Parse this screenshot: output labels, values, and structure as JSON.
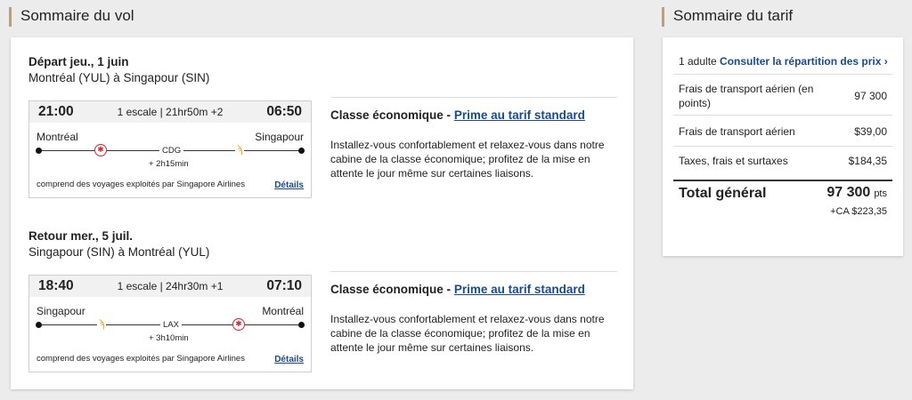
{
  "flight_summary": {
    "title": "Sommaire du vol",
    "legs": [
      {
        "heading": "Départ jeu., 1 juin",
        "route": "Montréal (YUL) à Singapour (SIN)",
        "depart_time": "21:00",
        "stops": "1 escale | 21hr50m +2",
        "arrive_time": "06:50",
        "origin_city": "Montréal",
        "dest_city": "Singapour",
        "via": "CDG",
        "layover": "+ 2h15min",
        "operated_by": "comprend des voyages exploités par Singapore Airlines",
        "details_label": "Détails",
        "cabin_label": "Classe économique -",
        "fare_link": "Prime au tarif standard",
        "description": "Installez-vous confortablement et relaxez-vous dans notre cabine de la classe économique; profitez de la mise en attente le jour même sur certaines liaisons."
      },
      {
        "heading": "Retour mer., 5 juil.",
        "route": "Singapour (SIN) à Montréal (YUL)",
        "depart_time": "18:40",
        "stops": "1 escale | 24hr30m +1",
        "arrive_time": "07:10",
        "origin_city": "Singapour",
        "dest_city": "Montréal",
        "via": "LAX",
        "layover": "+ 3h10min",
        "operated_by": "comprend des voyages exploités par Singapore Airlines",
        "details_label": "Détails",
        "cabin_label": "Classe économique -",
        "fare_link": "Prime au tarif standard",
        "description": "Installez-vous confortablement et relaxez-vous dans notre cabine de la classe économique; profitez de la mise en attente le jour même sur certaines liaisons."
      }
    ]
  },
  "fare_summary": {
    "title": "Sommaire du tarif",
    "passengers": "1 adulte",
    "breakdown_link": "Consulter la répartition des prix",
    "rows": [
      {
        "label": "Frais de transport aérien (en points)",
        "value": "97 300"
      },
      {
        "label": "Frais de transport aérien",
        "value": "$39,00"
      },
      {
        "label": "Taxes, frais et surtaxes",
        "value": "$184,35"
      }
    ],
    "total_label": "Total général",
    "total_points": "97 300",
    "points_unit": "pts",
    "total_cash": "+CA $223,35"
  },
  "icons": {
    "air_canada": "maple-leaf-icon",
    "singapore_airlines": "bird-logo-icon",
    "chevron": "chevron-right-icon"
  },
  "colors": {
    "accent": "#b8a07e",
    "link": "#1a4a8a",
    "air_canada_red": "#d22630",
    "sq_gold": "#e8a92c"
  }
}
